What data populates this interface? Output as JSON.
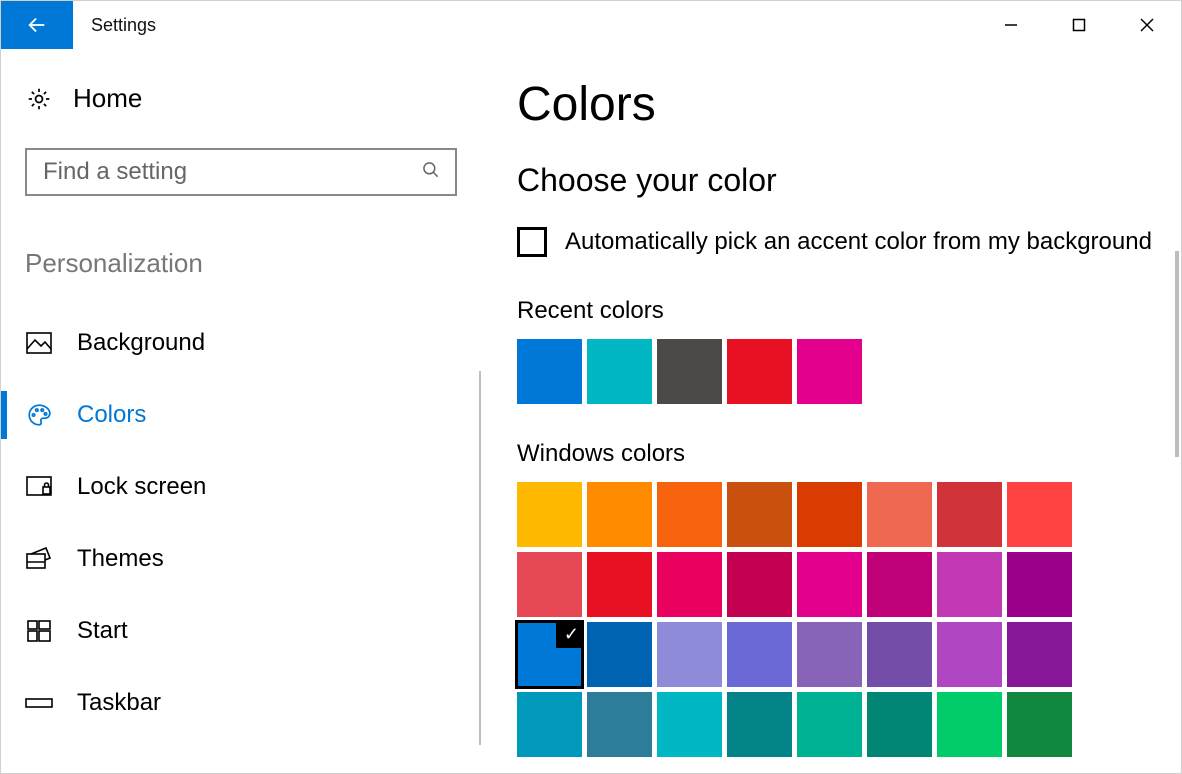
{
  "window": {
    "title": "Settings"
  },
  "sidebar": {
    "home_label": "Home",
    "search_placeholder": "Find a setting",
    "section_label": "Personalization",
    "items": [
      {
        "id": "background",
        "label": "Background",
        "active": false
      },
      {
        "id": "colors",
        "label": "Colors",
        "active": true
      },
      {
        "id": "lock-screen",
        "label": "Lock screen",
        "active": false
      },
      {
        "id": "themes",
        "label": "Themes",
        "active": false
      },
      {
        "id": "start",
        "label": "Start",
        "active": false
      },
      {
        "id": "taskbar",
        "label": "Taskbar",
        "active": false
      }
    ]
  },
  "main": {
    "title": "Colors",
    "subtitle": "Choose your color",
    "auto_pick_label": "Automatically pick an accent color from my background",
    "auto_pick_checked": false,
    "recent_label": "Recent colors",
    "recent_colors": [
      "#0078d7",
      "#00b7c3",
      "#4c4a48",
      "#e81123",
      "#e3008c"
    ],
    "windows_label": "Windows colors",
    "windows_colors": [
      "#ffb900",
      "#ff8c00",
      "#f7630c",
      "#ca5010",
      "#da3b01",
      "#ef6950",
      "#d13438",
      "#ff4343",
      "#e74856",
      "#e81123",
      "#ea005e",
      "#c30052",
      "#e3008c",
      "#bf0077",
      "#c239b3",
      "#9a0089",
      "#0078d7",
      "#0063b1",
      "#8e8cd8",
      "#6b69d6",
      "#8764b8",
      "#744da9",
      "#b146c2",
      "#881798",
      "#0099bc",
      "#2d7d9a",
      "#00b7c3",
      "#038387",
      "#00b294",
      "#018574",
      "#00cc6a",
      "#10893e"
    ],
    "selected_color": "#0078d7"
  }
}
